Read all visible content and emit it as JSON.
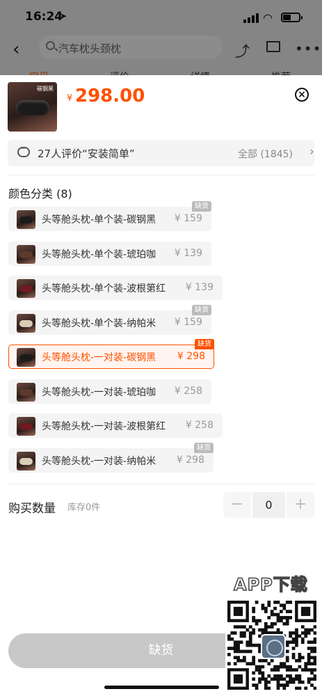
{
  "status_bar": {
    "time": "16:24"
  },
  "nav": {
    "search_text": "汽车枕头颈枕",
    "tabs": [
      "宝贝",
      "评价",
      "详情",
      "推荐"
    ]
  },
  "product": {
    "thumb_label": "碳钢黑",
    "price_symbol": "¥",
    "price": "298.00"
  },
  "review": {
    "text": "27人评价“安装简单”",
    "all_label": "全部 (1845)"
  },
  "section_title": "颜色分类 (8)",
  "options": [
    {
      "label": "头等舱头枕-单个装-碳钢黑",
      "price": "¥ 159",
      "badge": "缺货",
      "color": "#1b1b1b"
    },
    {
      "label": "头等舱头枕-单个装-琥珀咖",
      "price": "¥ 139",
      "badge": "",
      "color": "#5b3a2c"
    },
    {
      "label": "头等舱头枕-单个装-波根第红",
      "price": "¥ 139",
      "badge": "",
      "color": "#6e1a22"
    },
    {
      "label": "头等舱头枕-单个装-纳帕米",
      "price": "¥ 159",
      "badge": "缺货",
      "color": "#d9cdb6"
    },
    {
      "label": "头等舱头枕-一对装-碳钢黑",
      "price": "¥ 298",
      "badge": "缺货",
      "color": "#1b1b1b",
      "selected": true
    },
    {
      "label": "头等舱头枕-一对装-琥珀咖",
      "price": "¥ 258",
      "badge": "",
      "color": "#5b3a2c"
    },
    {
      "label": "头等舱头枕-一对装-波根第红",
      "price": "¥ 258",
      "badge": "",
      "color": "#6e1a22"
    },
    {
      "label": "头等舱头枕-一对装-纳帕米",
      "price": "¥ 298",
      "badge": "缺货",
      "color": "#d9cdb6"
    }
  ],
  "quantity": {
    "label": "购买数量",
    "stock": "库存0件",
    "value": "0",
    "minus": "−",
    "plus": "+"
  },
  "buy_button": "缺货",
  "overlay": {
    "app_download": "APP下载"
  },
  "colors": {
    "accent": "#ff5000",
    "disabled": "#c8c8c8"
  }
}
